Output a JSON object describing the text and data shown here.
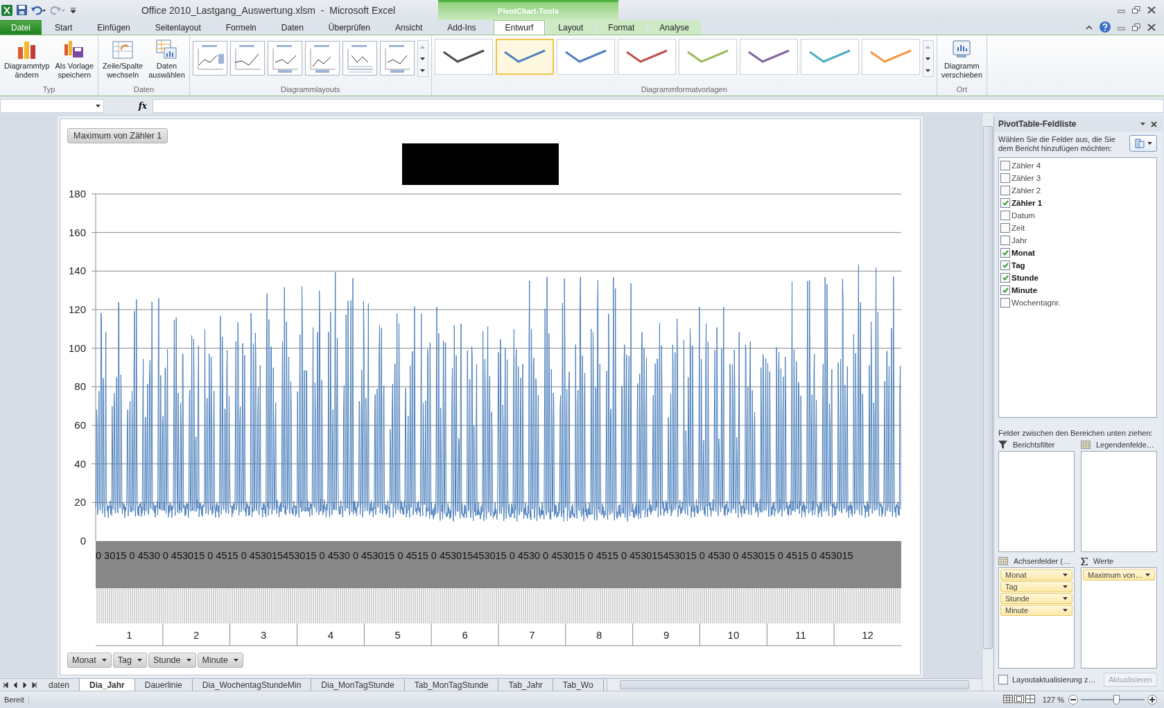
{
  "title_bar": {
    "title": "Office 2010_Lastgang_Auswertung.xlsm  -  Microsoft Excel",
    "context_label": "PivotChart-Tools"
  },
  "ribbon_tabs": [
    {
      "label": "Datei",
      "kind": "file",
      "selected": false
    },
    {
      "label": "Start",
      "kind": "tab",
      "selected": false
    },
    {
      "label": "Einfügen",
      "kind": "tab",
      "selected": false
    },
    {
      "label": "Seitenlayout",
      "kind": "tab",
      "selected": false
    },
    {
      "label": "Formeln",
      "kind": "tab",
      "selected": false
    },
    {
      "label": "Daten",
      "kind": "tab",
      "selected": false
    },
    {
      "label": "Überprüfen",
      "kind": "tab",
      "selected": false
    },
    {
      "label": "Ansicht",
      "kind": "tab",
      "selected": false
    },
    {
      "label": "Add-Ins",
      "kind": "tab",
      "selected": false
    },
    {
      "label": "Entwurf",
      "kind": "context",
      "selected": true
    },
    {
      "label": "Layout",
      "kind": "context",
      "selected": false
    },
    {
      "label": "Format",
      "kind": "context",
      "selected": false
    },
    {
      "label": "Analyse",
      "kind": "context",
      "selected": false
    }
  ],
  "ribbon": {
    "groups": [
      {
        "title": "Typ",
        "kind": "buttons",
        "buttons": [
          {
            "lines": [
              "Diagrammtyp",
              "ändern"
            ],
            "kind": "chart-type"
          },
          {
            "lines": [
              "Als Vorlage",
              "speichern"
            ],
            "kind": "template"
          }
        ]
      },
      {
        "title": "Daten",
        "kind": "buttons",
        "buttons": [
          {
            "lines": [
              "Zeile/Spalte",
              "wechseln"
            ],
            "kind": "switch"
          },
          {
            "lines": [
              "Daten",
              "auswählen"
            ],
            "kind": "select-data"
          }
        ]
      },
      {
        "title": "Diagrammlayouts",
        "kind": "layouts"
      },
      {
        "title": "Diagrammformatvorlagen",
        "kind": "styles",
        "styles": [
          {
            "color": "#4d4d4d",
            "selected": false
          },
          {
            "color": "#4f81bd",
            "selected": true
          },
          {
            "color": "#4f81bd",
            "selected": false
          },
          {
            "color": "#c0504d",
            "selected": false
          },
          {
            "color": "#9bbb59",
            "selected": false
          },
          {
            "color": "#8064a2",
            "selected": false
          },
          {
            "color": "#4bacc6",
            "selected": false
          },
          {
            "color": "#f79646",
            "selected": false
          }
        ]
      },
      {
        "title": "Ort",
        "kind": "buttons",
        "buttons": [
          {
            "lines": [
              "Diagramm",
              "verschieben"
            ],
            "kind": "move"
          }
        ]
      }
    ]
  },
  "formula_bar": {
    "fx_label": "fx"
  },
  "chart": {
    "value_button": "Maximum von Zähler 1",
    "y_labels": [
      "180",
      "160",
      "140",
      "120",
      "100",
      "80",
      "60",
      "40",
      "20",
      "0"
    ],
    "minute_labels": "0 3015 0 4530 0 453015 0 4515 0 453015453015 0 4530 0 453015 0 4515 0 453015453015 0 4530 0 453015 0 4515 0 453015453015 0 4530 0 453015 0 4515 0 453015",
    "month_labels": [
      "1",
      "2",
      "3",
      "4",
      "5",
      "6",
      "7",
      "8",
      "9",
      "10",
      "11",
      "12"
    ],
    "field_buttons": [
      "Monat",
      "Tag",
      "Stunde",
      "Minute"
    ]
  },
  "field_list": {
    "title": "PivotTable-Feldliste",
    "instruction": "Wählen Sie die Felder aus, die Sie dem Bericht hinzufügen möchten:",
    "fields": [
      {
        "label": "Zähler 4",
        "checked": false
      },
      {
        "label": "Zähler 3",
        "checked": false
      },
      {
        "label": "Zähler 2",
        "checked": false
      },
      {
        "label": "Zähler 1",
        "checked": true
      },
      {
        "label": "Datum",
        "checked": false
      },
      {
        "label": "Zeit",
        "checked": false
      },
      {
        "label": "Jahr",
        "checked": false
      },
      {
        "label": "Monat",
        "checked": true
      },
      {
        "label": "Tag",
        "checked": true
      },
      {
        "label": "Stunde",
        "checked": true
      },
      {
        "label": "Minute",
        "checked": true
      },
      {
        "label": "Wochentagnr.",
        "checked": false
      }
    ],
    "drag_hint": "Felder zwischen den Bereichen unten ziehen:",
    "areas": [
      {
        "kind": "filter",
        "title": "Berichtsfilter"
      },
      {
        "kind": "legend",
        "title": "Legendenfelde…"
      },
      {
        "kind": "axis",
        "title": "Achsenfelder (…",
        "items": [
          "Monat",
          "Tag",
          "Stunde",
          "Minute"
        ]
      },
      {
        "kind": "values",
        "title": "Werte",
        "items": [
          "Maximum von…"
        ]
      }
    ],
    "defer": {
      "label": "Layoutaktualisierung z…",
      "checked": false
    },
    "update_button": {
      "label": "Aktualisieren",
      "disabled": true
    }
  },
  "sheet_tabs": [
    {
      "label": "daten",
      "selected": false
    },
    {
      "label": "Dia_Jahr",
      "selected": true
    },
    {
      "label": "Dauerlinie",
      "selected": false
    },
    {
      "label": "Dia_WochentagStundeMin",
      "selected": false
    },
    {
      "label": "Dia_MonTagStunde",
      "selected": false
    },
    {
      "label": "Tab_MonTagStunde",
      "selected": false
    },
    {
      "label": "Tab_Jahr",
      "selected": false
    },
    {
      "label": "Tab_Wo",
      "selected": false
    }
  ],
  "status_bar": {
    "status": "Bereit",
    "zoom": "127 %",
    "zoom_slider": {
      "level": 0.55
    }
  }
}
